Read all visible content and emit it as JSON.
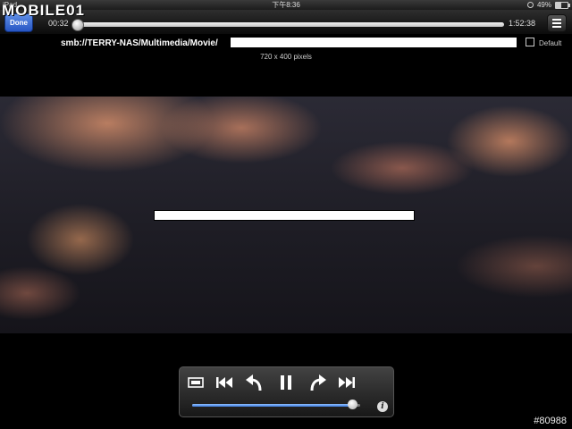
{
  "status_bar": {
    "device": "iPad",
    "clock": "下午8:36",
    "battery": "49%",
    "battery_level": 0.49
  },
  "watermark": "MOBILE01",
  "topbar": {
    "done_label": "Done",
    "elapsed": "00:32",
    "total": "1:52:38",
    "progress": 0.005
  },
  "media": {
    "path": "smb://TERRY-NAS/Multimedia/Movie/",
    "aspect_label": "Default",
    "resolution": "720 x 400 pixels"
  },
  "controls": {
    "volume": 0.95
  },
  "footer": {
    "image_id": "#80988"
  },
  "colors": {
    "done_button": "#3a6fd6",
    "volume_fill": "#5a95f0"
  },
  "icons": [
    "aspect-ratio-icon",
    "skip-back-icon",
    "rewind-icon",
    "pause-icon",
    "forward-icon",
    "skip-forward-icon",
    "menu-icon",
    "info-icon",
    "battery-icon",
    "lock-rotation-icon"
  ]
}
